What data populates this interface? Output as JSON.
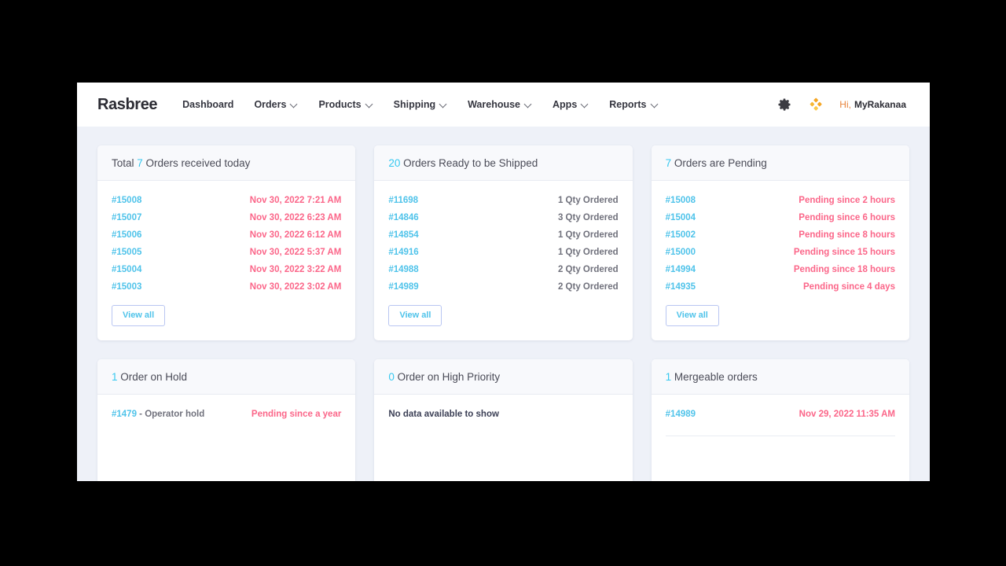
{
  "navbar": {
    "brand": "Rasbree",
    "links": [
      {
        "label": "Dashboard",
        "has_caret": false
      },
      {
        "label": "Orders",
        "has_caret": true
      },
      {
        "label": "Products",
        "has_caret": true
      },
      {
        "label": "Shipping",
        "has_caret": true
      },
      {
        "label": "Warehouse",
        "has_caret": true
      },
      {
        "label": "Apps",
        "has_caret": true
      },
      {
        "label": "Reports",
        "has_caret": true
      }
    ],
    "settings_icon": "gear-icon",
    "apps_icon": "diamond-cluster-icon",
    "greeting_prefix": "Hi,",
    "username": "MyRakanaa"
  },
  "colors": {
    "accent_cyan": "#35c8f0",
    "link_cyan": "#4fc3ea",
    "alert_pink": "#fb6689",
    "muted_gray": "#70717c",
    "page_bg": "#eef1f8",
    "card_header_bg": "#f8f9fc",
    "orange": "#e8833a"
  },
  "cards": {
    "orders_received": {
      "count": "7",
      "title_before": "Total ",
      "title_after": " Orders received today",
      "rows": [
        {
          "id": "#15008",
          "value": "Nov 30, 2022 7:21 AM"
        },
        {
          "id": "#15007",
          "value": "Nov 30, 2022 6:23 AM"
        },
        {
          "id": "#15006",
          "value": "Nov 30, 2022 6:12 AM"
        },
        {
          "id": "#15005",
          "value": "Nov 30, 2022 5:37 AM"
        },
        {
          "id": "#15004",
          "value": "Nov 30, 2022 3:22 AM"
        },
        {
          "id": "#15003",
          "value": "Nov 30, 2022 3:02 AM"
        }
      ],
      "view_all": "View all"
    },
    "ready_to_ship": {
      "count": "20",
      "title_before": "",
      "title_after": " Orders Ready to be Shipped",
      "rows": [
        {
          "id": "#11698",
          "value": "1 Qty Ordered"
        },
        {
          "id": "#14846",
          "value": "3 Qty Ordered"
        },
        {
          "id": "#14854",
          "value": "1 Qty Ordered"
        },
        {
          "id": "#14916",
          "value": "1 Qty Ordered"
        },
        {
          "id": "#14988",
          "value": "2 Qty Ordered"
        },
        {
          "id": "#14989",
          "value": "2 Qty Ordered"
        }
      ],
      "view_all": "View all"
    },
    "pending": {
      "count": "7",
      "title_before": "",
      "title_after": " Orders are Pending",
      "rows": [
        {
          "id": "#15008",
          "value": "Pending since 2 hours"
        },
        {
          "id": "#15004",
          "value": "Pending since 6 hours"
        },
        {
          "id": "#15002",
          "value": "Pending since 8 hours"
        },
        {
          "id": "#15000",
          "value": "Pending since 15 hours"
        },
        {
          "id": "#14994",
          "value": "Pending since 18 hours"
        },
        {
          "id": "#14935",
          "value": "Pending since 4 days"
        }
      ],
      "view_all": "View all"
    },
    "on_hold": {
      "count": "1",
      "title_before": "",
      "title_after": " Order on Hold",
      "rows": [
        {
          "id": "#1479",
          "id_suffix": " - Operator hold",
          "value": "Pending since a year"
        }
      ]
    },
    "high_priority": {
      "count": "0",
      "title_before": "",
      "title_after": " Order on High Priority",
      "empty_message": "No data available to show"
    },
    "mergeable": {
      "count": "1",
      "title_before": "",
      "title_after": " Mergeable orders",
      "rows": [
        {
          "id": "#14989",
          "value": "Nov 29, 2022 11:35 AM"
        }
      ]
    }
  }
}
